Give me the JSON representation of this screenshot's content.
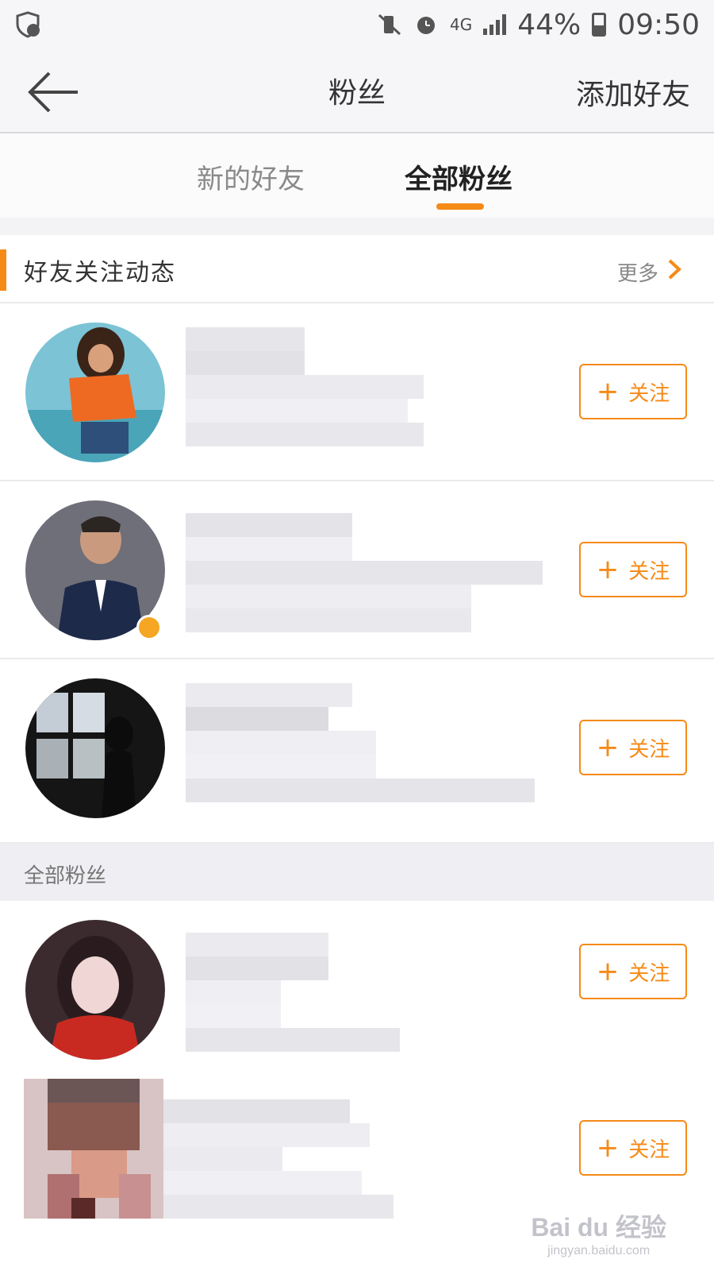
{
  "status_bar": {
    "network": "4G",
    "battery": "44%",
    "time": "09:50"
  },
  "header": {
    "title": "粉丝",
    "action": "添加好友"
  },
  "tabs": [
    {
      "label": "新的好友",
      "active": false
    },
    {
      "label": "全部粉丝",
      "active": true
    }
  ],
  "friends_activity": {
    "title": "好友关注动态",
    "more": "更多"
  },
  "all_fans": {
    "title": "全部粉丝"
  },
  "follow_label": "关注",
  "colors": {
    "accent": "#f58a17",
    "verified_badge": "#f5a623"
  },
  "watermark": {
    "line1": "Bai du 经验",
    "line2": "jingyan.baidu.com"
  }
}
